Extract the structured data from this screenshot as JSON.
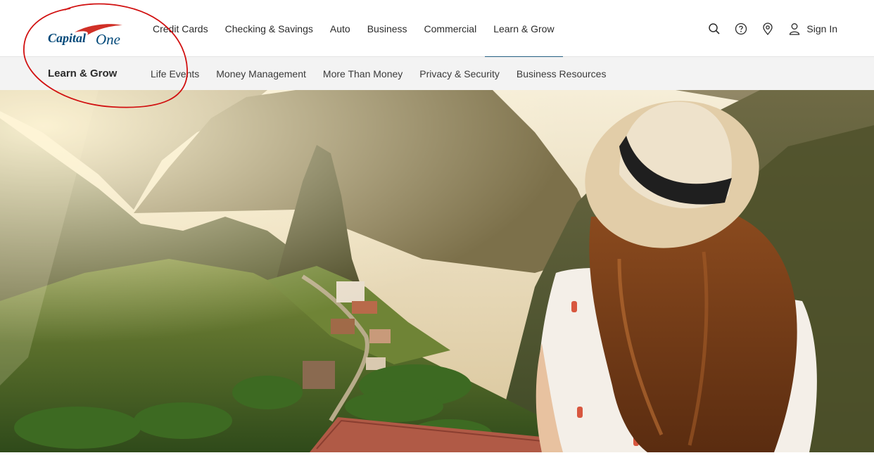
{
  "brand": {
    "name": "Capital One",
    "logo_text_1": "Capital",
    "logo_text_2": "One"
  },
  "top_nav": {
    "links": [
      {
        "label": "Credit Cards",
        "active": false
      },
      {
        "label": "Checking & Savings",
        "active": false
      },
      {
        "label": "Auto",
        "active": false
      },
      {
        "label": "Business",
        "active": false
      },
      {
        "label": "Commercial",
        "active": false
      },
      {
        "label": "Learn & Grow",
        "active": true
      }
    ],
    "utility_icons": [
      "search-icon",
      "help-icon",
      "location-pin-icon",
      "user-icon"
    ],
    "sign_in_label": "Sign In"
  },
  "sub_nav": {
    "title": "Learn & Grow",
    "links": [
      {
        "label": "Life Events"
      },
      {
        "label": "Money Management"
      },
      {
        "label": "More Than Money"
      },
      {
        "label": "Privacy & Security"
      },
      {
        "label": "Business Resources"
      }
    ]
  },
  "hero": {
    "image": "woman-in-straw-hat-overlooking-mountain-village"
  },
  "colors": {
    "brand_navy": "#004879",
    "brand_red": "#d03027",
    "active_underline": "#255f82",
    "subnav_bg": "#f3f3f3",
    "annotation_red": "#d11010"
  }
}
